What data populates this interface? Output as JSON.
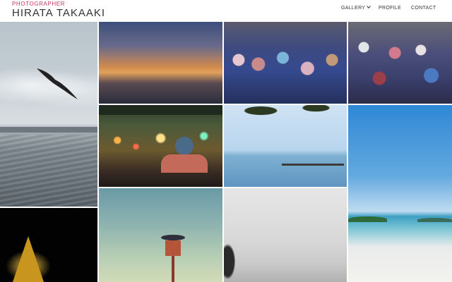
{
  "site": {
    "subtitle": "PHOTOGRAPHER",
    "name": "HIRATA TAKAAKI",
    "accent_color": "#c5365d"
  },
  "nav": {
    "items": [
      {
        "label": "GALLERY",
        "has_dropdown": true
      },
      {
        "label": "PROFILE"
      },
      {
        "label": "CONTACT"
      }
    ]
  },
  "gallery": {
    "tiles": [
      {
        "subject": "sea-with-bird"
      },
      {
        "subject": "sunset-blur"
      },
      {
        "subject": "crowd-1"
      },
      {
        "subject": "crowd-2"
      },
      {
        "subject": "night-street"
      },
      {
        "subject": "sea-pier"
      },
      {
        "subject": "beach"
      },
      {
        "subject": "golden-temple"
      },
      {
        "subject": "water-tower"
      },
      {
        "subject": "foggy-coast"
      }
    ]
  }
}
